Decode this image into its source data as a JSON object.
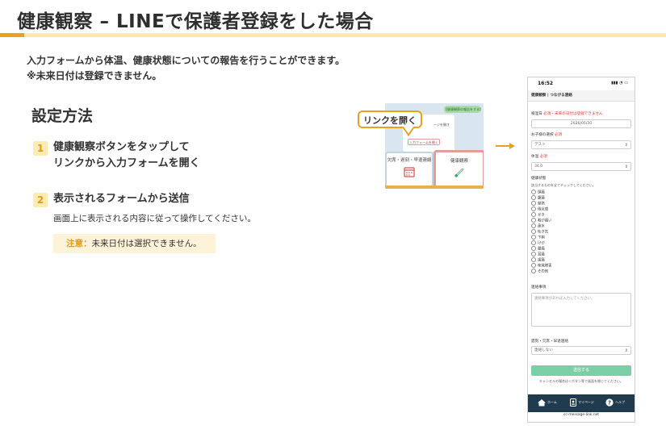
{
  "page": {
    "title": "健康観察 – LINEで保護者登録をした場合",
    "intro_line1": "入力フォームから体温、健康状態についての報告を行うことができます。",
    "intro_line2": "※未来日付は登録できません。",
    "section_title": "設定方法"
  },
  "steps": [
    {
      "num": "1",
      "line1": "健康観察ボタンをタップして",
      "line2": "リンクから入力フォームを開く"
    },
    {
      "num": "2",
      "line1": "表示されるフォームから送信",
      "desc": "画面上に表示される内容に従って操作してください。"
    }
  ],
  "note": {
    "label": "注意：",
    "text": "未来日付は選択できません。"
  },
  "preview": {
    "callout": "リンクを開く",
    "pill": "【健康観察の報告をする】",
    "card_text": "ージを開き",
    "form_link": "入力フォームを開く",
    "tile_absence": "欠席・遅刻・早退連絡",
    "tile_health": "健康観察"
  },
  "phone": {
    "time": "16:52",
    "status_icons": "5G",
    "header": "健康観察 | つながる連絡",
    "date_label": "検温日",
    "date_warning": "必須・未来の日付は登録できません",
    "date_value": "2026/05/20",
    "child_label": "お子様の選択",
    "required": "必須",
    "child_value": "テスト",
    "temp_label": "体温",
    "temp_value": "34.0",
    "condition_label": "健康状態",
    "condition_hint": "該当するものを全てチェックしてください。",
    "conditions": [
      "頭痛",
      "腹痛",
      "発熱",
      "倦怠感",
      "せき",
      "喉が痛い",
      "鼻水",
      "吐き気",
      "下痢",
      "けが",
      "腰痛",
      "耳痛",
      "歯痛",
      "味覚障害",
      "その他"
    ],
    "notes_label": "連絡事項",
    "notes_placeholder": "連絡事項があれば入力してください。",
    "absence_label": "遅刻・欠席・早退連絡",
    "absence_value": "連絡しない",
    "submit": "送信する",
    "cancel": "キャンセルの場合は＜ボタン等で画面を閉じてください。",
    "nav": [
      "ホーム",
      "マイページ",
      "ヘルプ"
    ],
    "url": "cc-message-link.net"
  }
}
